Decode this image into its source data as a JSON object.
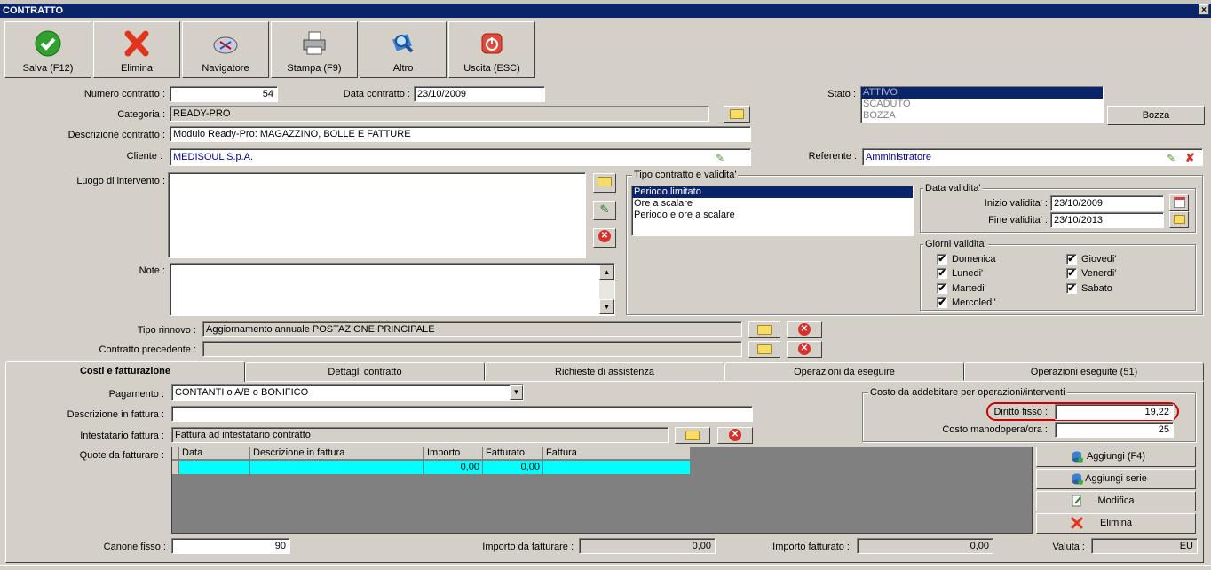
{
  "window": {
    "title": "CONTRATTO",
    "close_glyph": "×"
  },
  "toolbar": [
    {
      "label": "Salva (F12)",
      "icon": "check-icon"
    },
    {
      "label": "Elimina",
      "icon": "delete-x-icon"
    },
    {
      "label": "Navigatore",
      "icon": "compass-icon"
    },
    {
      "label": "Stampa (F9)",
      "icon": "printer-icon"
    },
    {
      "label": "Altro",
      "icon": "magnifier-icon"
    },
    {
      "label": "Uscita (ESC)",
      "icon": "power-icon"
    }
  ],
  "form": {
    "numero_label": "Numero contratto :",
    "numero_value": "54",
    "data_label": "Data contratto :",
    "data_value": "23/10/2009",
    "stato_label": "Stato :",
    "stato_options": [
      "ATTIVO",
      "SCADUTO",
      "BOZZA"
    ],
    "bozza_button": "Bozza",
    "categoria_label": "Categoria :",
    "categoria_value": "READY-PRO",
    "descrizione_label": "Descrizione contratto :",
    "descrizione_value": "Modulo Ready-Pro: MAGAZZINO, BOLLE E FATTURE",
    "cliente_label": "Cliente :",
    "cliente_value": "MEDISOUL S.p.A.",
    "referente_label": "Referente :",
    "referente_value": "Amministratore",
    "luogo_label": "Luogo di intervento :",
    "note_label": "Note :",
    "tipo_rinnovo_label": "Tipo rinnovo :",
    "tipo_rinnovo_value": "Aggiornamento annuale POSTAZIONE PRINCIPALE",
    "contratto_prec_label": "Contratto precedente :",
    "contratto_prec_value": ""
  },
  "tipo_contratto": {
    "title": "Tipo contratto e validita'",
    "options": [
      "Periodo limitato",
      "Ore a scalare",
      "Periodo e ore a scalare"
    ],
    "data_validita_title": "Data validita'",
    "inizio_label": "Inizio validita' :",
    "inizio_value": "23/10/2009",
    "fine_label": "Fine validita' :",
    "fine_value": "23/10/2013",
    "giorni_title": "Giorni validita'",
    "giorni": [
      {
        "label": "Domenica",
        "checked": true
      },
      {
        "label": "Lunedi'",
        "checked": true
      },
      {
        "label": "Martedi'",
        "checked": true
      },
      {
        "label": "Mercoledi'",
        "checked": true
      },
      {
        "label": "Giovedi'",
        "checked": true
      },
      {
        "label": "Venerdi'",
        "checked": true
      },
      {
        "label": "Sabato",
        "checked": true
      }
    ],
    "check_glyph": "✔"
  },
  "tabs": [
    "Costi e fatturazione",
    "Dettagli contratto",
    "Richieste di assistenza",
    "Operazioni da eseguire",
    "Operazioni eseguite (51)"
  ],
  "costi": {
    "pagamento_label": "Pagamento :",
    "pagamento_value": "CONTANTI o A/B o BONIFICO",
    "descr_fattura_label": "Descrizione in fattura :",
    "descr_fattura_value": "",
    "intestatario_label": "Intestatario fattura :",
    "intestatario_value": "Fattura ad intestatario contratto",
    "quote_label": "Quote da fatturare :",
    "grid_headers": [
      "Data",
      "Descrizione in fattura",
      "Importo",
      "Fatturato",
      "Fattura"
    ],
    "grid_rows": [
      [
        "",
        "",
        "0,00",
        "0,00",
        ""
      ]
    ],
    "costo_title": "Costo da addebitare per operazioni/interventi",
    "diritto_label": "Diritto fisso :",
    "diritto_value": "19,22",
    "manodopera_label": "Costo manodopera/ora :",
    "manodopera_value": "25",
    "buttons": [
      "Aggiungi (F4)",
      "Aggiungi serie",
      "Modifica",
      "Elimina"
    ],
    "canone_label": "Canone fisso :",
    "canone_value": "90",
    "importo_da_fatt_label": "Importo da fatturare :",
    "importo_da_fatt_value": "0,00",
    "importo_fatt_label": "Importo fatturato :",
    "importo_fatt_value": "0,00",
    "valuta_label": "Valuta :",
    "valuta_value": "EU"
  },
  "colors": {
    "titlebar": "#0a246a",
    "selection": "#0a246a",
    "grid_row": "#00ffff",
    "highlight_ring": "#cc0000",
    "face": "#d4d0c8"
  }
}
